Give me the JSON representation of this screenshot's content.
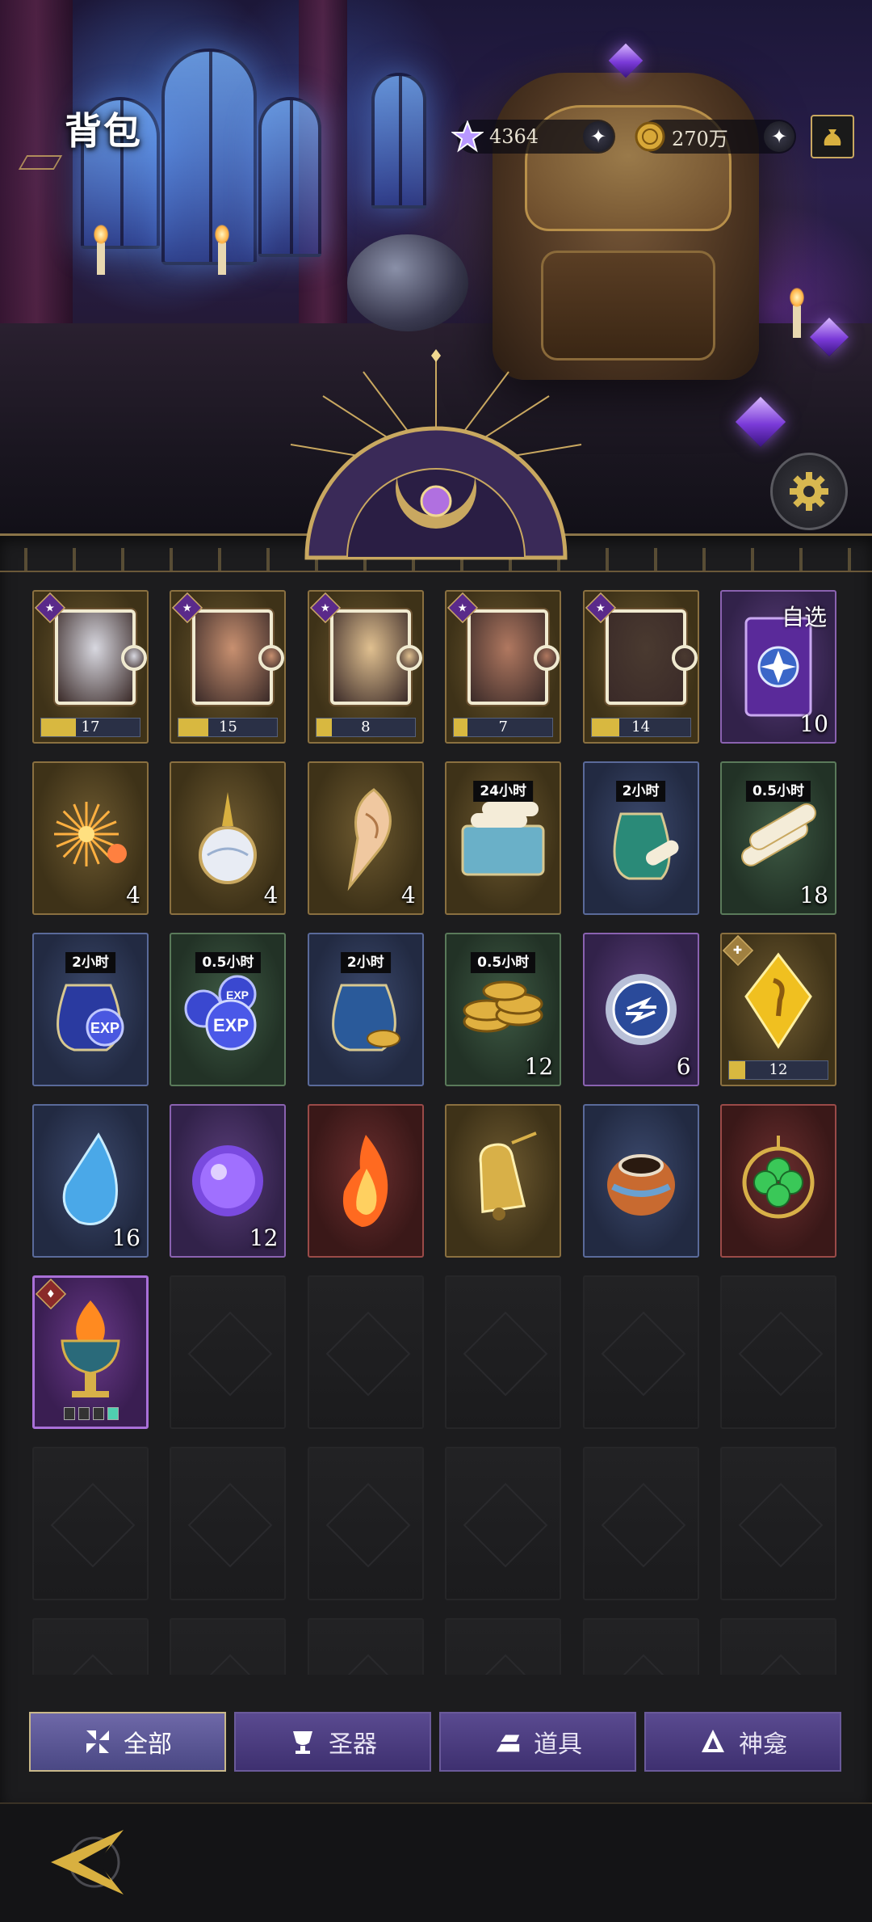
{
  "header": {
    "title": "背包",
    "crystal_amount": "4364",
    "gold_amount": "270万"
  },
  "inventory": [
    {
      "kind": "fragment",
      "rarity": "gold",
      "count": "17",
      "progress": 0.35
    },
    {
      "kind": "fragment",
      "rarity": "gold",
      "count": "15",
      "progress": 0.3
    },
    {
      "kind": "fragment",
      "rarity": "gold",
      "count": "8",
      "progress": 0.16
    },
    {
      "kind": "fragment",
      "rarity": "gold",
      "count": "7",
      "progress": 0.14
    },
    {
      "kind": "fragment",
      "rarity": "gold",
      "count": "14",
      "progress": 0.28
    },
    {
      "kind": "card-pack",
      "rarity": "purple",
      "tag": "自选",
      "count": "10"
    },
    {
      "kind": "fireworks",
      "rarity": "gold",
      "count": "4"
    },
    {
      "kind": "potion-flask",
      "rarity": "gold",
      "count": "4"
    },
    {
      "kind": "conch-horn",
      "rarity": "gold",
      "count": "4"
    },
    {
      "kind": "scroll-chest",
      "rarity": "gold",
      "time": "24小时"
    },
    {
      "kind": "scroll-bag",
      "rarity": "blue",
      "time": "2小时"
    },
    {
      "kind": "scrolls",
      "rarity": "green",
      "time": "0.5小时",
      "count": "18"
    },
    {
      "kind": "exp-bag",
      "rarity": "blue",
      "time": "2小时"
    },
    {
      "kind": "exp-orbs",
      "rarity": "green",
      "time": "0.5小时"
    },
    {
      "kind": "coin-bag",
      "rarity": "blue",
      "time": "2小时"
    },
    {
      "kind": "coin-stack",
      "rarity": "green",
      "time": "0.5小时",
      "count": "12"
    },
    {
      "kind": "rune-disc",
      "rarity": "purple",
      "count": "6"
    },
    {
      "kind": "gold-shard",
      "rarity": "gold",
      "count": "12",
      "progress": 0.16
    },
    {
      "kind": "water-drop",
      "rarity": "blue",
      "count": "16"
    },
    {
      "kind": "purple-orb",
      "rarity": "purple",
      "count": "12"
    },
    {
      "kind": "flame",
      "rarity": "red"
    },
    {
      "kind": "bell",
      "rarity": "gold"
    },
    {
      "kind": "urn",
      "rarity": "blue"
    },
    {
      "kind": "clover-amulet",
      "rarity": "red"
    },
    {
      "kind": "fire-chalice",
      "rarity": "violet",
      "stars_filled": 1,
      "stars_total": 4
    }
  ],
  "tabs": [
    {
      "label": "全部",
      "icon": "grid-icon",
      "active": true
    },
    {
      "label": "圣器",
      "icon": "chalice-icon",
      "active": false
    },
    {
      "label": "道具",
      "icon": "ingots-icon",
      "active": false
    },
    {
      "label": "神龛",
      "icon": "shrine-icon",
      "active": false
    }
  ],
  "colors": {
    "accent_gold": "#c9a860",
    "tab_purple": "#4a3c80",
    "panel_bg": "#1c1c1e"
  }
}
